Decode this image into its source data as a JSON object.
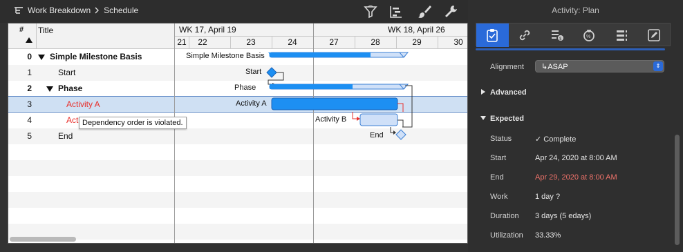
{
  "breadcrumb": {
    "items": [
      "Work Breakdown",
      "Schedule"
    ]
  },
  "toolbar": {
    "icons": [
      "filter-icon",
      "gantt-icon",
      "brush-icon",
      "wrench-icon"
    ]
  },
  "table": {
    "headers": {
      "num": "#",
      "title": "Title"
    },
    "rows": [
      {
        "num": "0",
        "title": "Simple Milestone Basis",
        "bold": true,
        "expanded": true
      },
      {
        "num": "1",
        "title": "Start"
      },
      {
        "num": "2",
        "title": "Phase",
        "bold": true,
        "expanded": true
      },
      {
        "num": "3",
        "title": "Activity A",
        "status": "violated"
      },
      {
        "num": "4",
        "title": "Activity B",
        "status": "violated"
      },
      {
        "num": "5",
        "title": "End"
      }
    ]
  },
  "gantt": {
    "weeks": [
      "WK 17, April 19",
      "WK 18, April 26"
    ],
    "days": [
      "21",
      "22",
      "23",
      "24",
      "27",
      "28",
      "29",
      "30"
    ],
    "labels": [
      "Simple Milestone Basis",
      "Start",
      "Phase",
      "Activity A",
      "Activity B",
      "End"
    ]
  },
  "tooltip": "Dependency order is violated.",
  "inspector": {
    "title": "Activity: Plan",
    "tabs": [
      "clipboard-icon",
      "link-icon",
      "cost-icon",
      "progress-icon",
      "list-icon",
      "edit-icon"
    ],
    "alignment": {
      "label": "Alignment",
      "value": "↳ASAP"
    },
    "advanced": "Advanced",
    "expected": "Expected",
    "fields": [
      {
        "label": "Status",
        "value": "✓ Complete"
      },
      {
        "label": "Start",
        "value": "Apr 24, 2020 at 8:00 AM"
      },
      {
        "label": "End",
        "value": "Apr 29, 2020 at 8:00 AM",
        "color": "#f0736b"
      },
      {
        "label": "Work",
        "value": "1 day ?"
      },
      {
        "label": "Duration",
        "value": "3 days (5 edays)"
      },
      {
        "label": "Utilization",
        "value": "33.33%"
      }
    ]
  },
  "colors": {
    "accent": "#2a6ad9",
    "bar": "#1d8ff2",
    "violation": "#e8302c"
  }
}
